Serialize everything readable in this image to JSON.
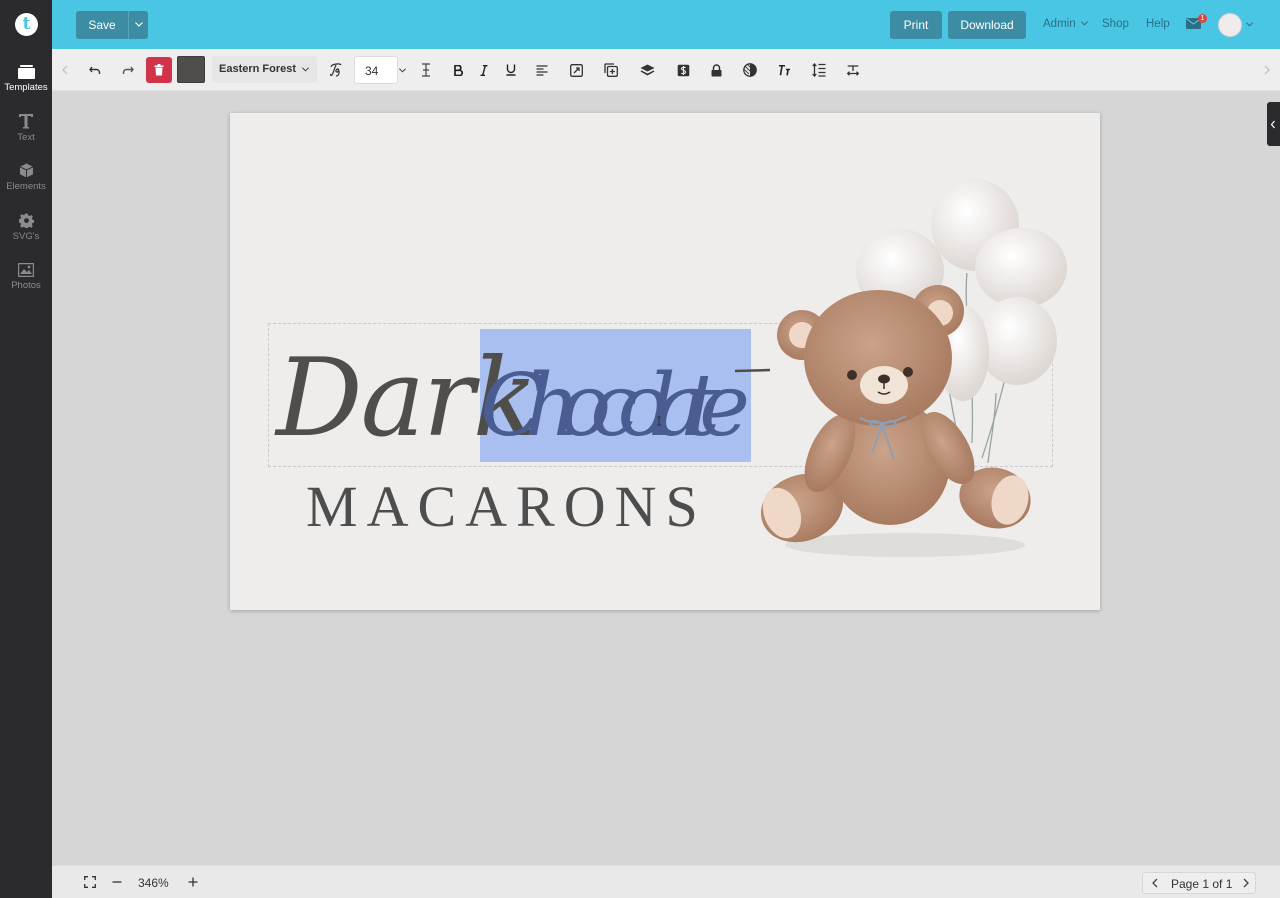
{
  "app": {
    "logo_letter": "t"
  },
  "sidebar": {
    "items": [
      {
        "label": "Templates",
        "icon": "templates-icon",
        "active": true
      },
      {
        "label": "Text",
        "icon": "text-icon",
        "active": false
      },
      {
        "label": "Elements",
        "icon": "cube-icon",
        "active": false
      },
      {
        "label": "SVG's",
        "icon": "gear-icon",
        "active": false
      },
      {
        "label": "Photos",
        "icon": "image-icon",
        "active": false
      }
    ]
  },
  "topbar": {
    "save_label": "Save",
    "print_label": "Print",
    "download_label": "Download",
    "admin_label": "Admin",
    "shop_label": "Shop",
    "help_label": "Help",
    "mail_count": "1"
  },
  "toolbar": {
    "font_name": "Eastern Forest",
    "font_size": "34",
    "text_color": "#4f4e4a"
  },
  "canvas": {
    "script_text_1": "Dark",
    "script_text_2": "Chocolate",
    "title_text": "MACARONS",
    "selection_color": "#a9bff0"
  },
  "bottombar": {
    "zoom": "346%",
    "page_label": "Page 1 of 1"
  },
  "colors": {
    "topbar": "#48c6e4",
    "button": "#3c8ca3",
    "sidebar": "#2b2b2d",
    "delete": "#d2334a"
  }
}
